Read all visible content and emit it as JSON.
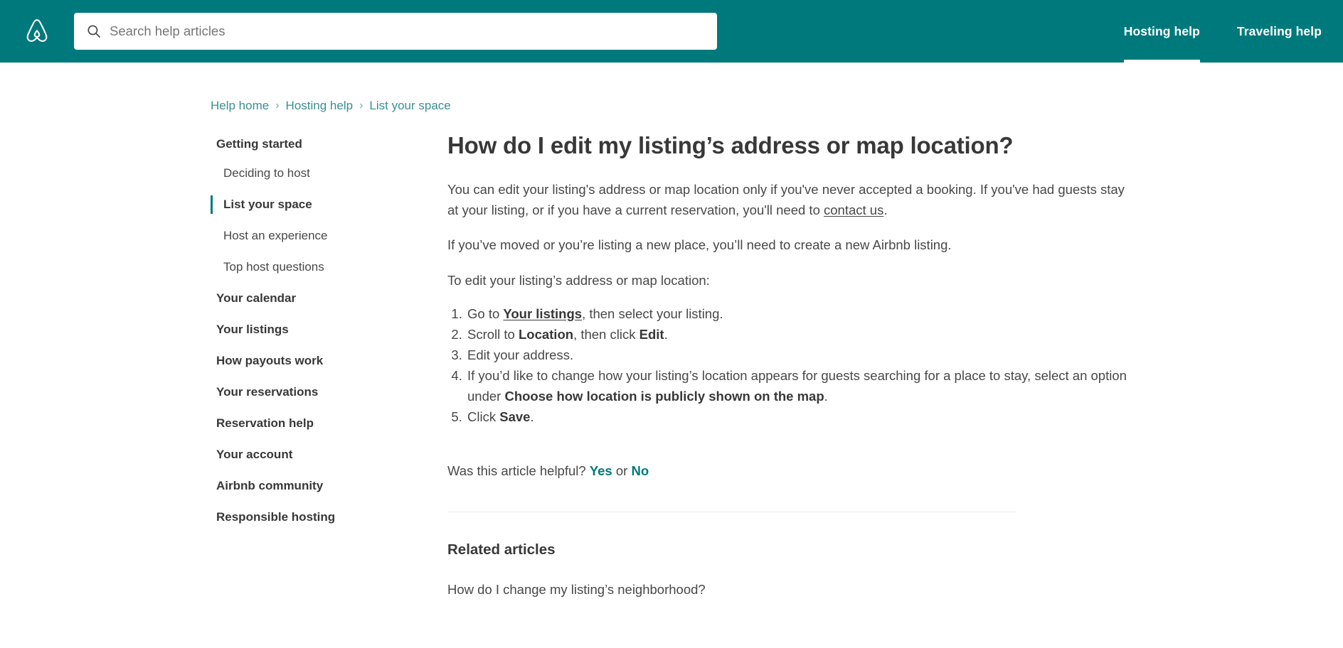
{
  "brand": {
    "logo_icon": "airbnb-belo-logo",
    "accent_teal": "#00797C",
    "link_teal": "#3A8F93"
  },
  "header": {
    "search": {
      "icon": "search-icon",
      "placeholder": "Search help articles",
      "value": ""
    },
    "nav": [
      {
        "label": "Hosting help",
        "active": true
      },
      {
        "label": "Traveling help",
        "active": false
      }
    ]
  },
  "breadcrumb": {
    "separator": "›",
    "items": [
      {
        "label": "Help home"
      },
      {
        "label": "Hosting help"
      },
      {
        "label": "List your space"
      }
    ]
  },
  "sidebar": {
    "group": {
      "title": "Getting started",
      "children": [
        {
          "label": "Deciding to host",
          "active": false
        },
        {
          "label": "List your space",
          "active": true
        },
        {
          "label": "Host an experience",
          "active": false
        },
        {
          "label": "Top host questions",
          "active": false
        }
      ]
    },
    "links": [
      {
        "label": "Your calendar"
      },
      {
        "label": "Your listings"
      },
      {
        "label": "How payouts work"
      },
      {
        "label": "Your reservations"
      },
      {
        "label": "Reservation help"
      },
      {
        "label": "Your account"
      },
      {
        "label": "Airbnb community"
      },
      {
        "label": "Responsible hosting"
      }
    ]
  },
  "article": {
    "title": "How do I edit my listing’s address or map location?",
    "paragraph_1": {
      "before_link": "You can edit your listing's address or map location only if you've never accepted a booking. If you've had guests stay at your listing, or if you have a current reservation, you'll need to ",
      "link": "contact us",
      "after_link": "."
    },
    "paragraph_2": "If you’ve moved or you’re listing a new place, you’ll need to create a new Airbnb listing.",
    "paragraph_3": "To edit your listing’s address or map location:",
    "steps": [
      {
        "pre": "Go to ",
        "link": "Your listings",
        "mid": ", then select your listing.",
        "strong": "",
        "post": ""
      },
      {
        "pre": "Scroll to ",
        "link": "",
        "mid": "",
        "strong": "Location",
        "post": ", then click "
      },
      {
        "pre": "Edit your address.",
        "link": "",
        "mid": "",
        "strong": "",
        "post": ""
      },
      {
        "pre": "If you’d like to change how your listing’s location appears for guests searching for a place to stay, select an option under ",
        "link": "",
        "mid": "",
        "strong": "Choose how location is publicly shown on the map",
        "post": "."
      },
      {
        "pre": "Click ",
        "link": "",
        "mid": "",
        "strong": "Save",
        "post": "."
      }
    ],
    "step2_strong_2": "Edit",
    "step2_tail": ".",
    "feedback": {
      "question": "Was this article helpful?",
      "yes": "Yes",
      "or": "or",
      "no": "No"
    },
    "related": {
      "heading": "Related articles",
      "items": [
        {
          "label": "How do I change my listing’s neighborhood?"
        }
      ]
    }
  }
}
